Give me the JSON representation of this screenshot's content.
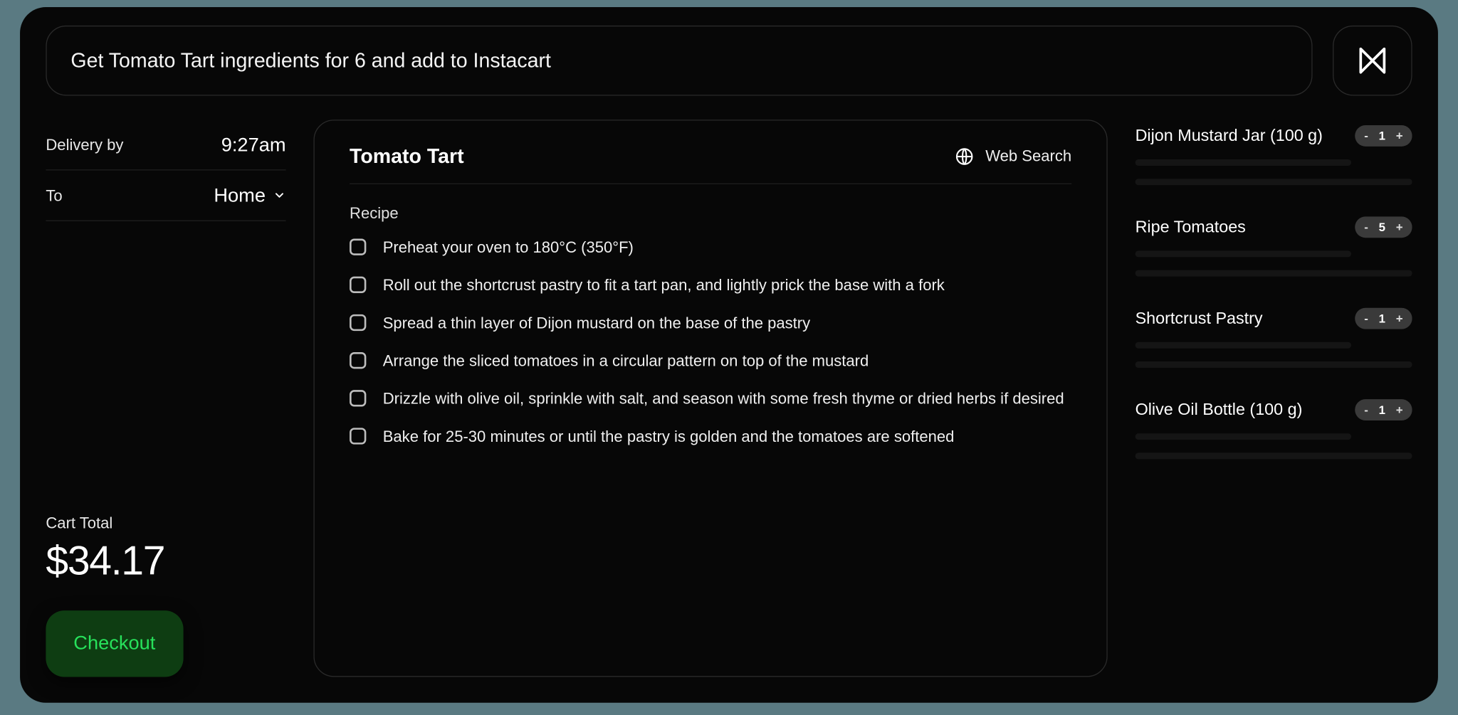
{
  "header": {
    "prompt": "Get Tomato Tart ingredients for 6 and add to Instacart"
  },
  "left": {
    "delivery_label": "Delivery by",
    "delivery_time": "9:27am",
    "to_label": "To",
    "to_value": "Home",
    "cart_total_label": "Cart Total",
    "cart_total_value": "$34.17",
    "checkout_label": "Checkout"
  },
  "center": {
    "title": "Tomato Tart",
    "web_search_label": "Web Search",
    "recipe_label": "Recipe",
    "steps": [
      "Preheat your oven to 180°C (350°F)",
      "Roll out the shortcrust pastry to fit a tart pan, and lightly prick the base with a fork",
      "Spread a thin layer of Dijon mustard on the base of the pastry",
      "Arrange the sliced tomatoes in a circular pattern on top of the mustard",
      "Drizzle with olive oil, sprinkle with salt, and season with some fresh thyme or dried herbs if desired",
      "Bake for 25-30 minutes or until the pastry is golden and the tomatoes are softened"
    ]
  },
  "right": {
    "items": [
      {
        "name": "Dijon Mustard Jar (100 g)",
        "qty": "1"
      },
      {
        "name": "Ripe Tomatoes",
        "qty": "5"
      },
      {
        "name": "Shortcrust Pastry",
        "qty": "1"
      },
      {
        "name": "Olive Oil Bottle (100 g)",
        "qty": "1"
      }
    ],
    "minus": "-",
    "plus": "+"
  }
}
